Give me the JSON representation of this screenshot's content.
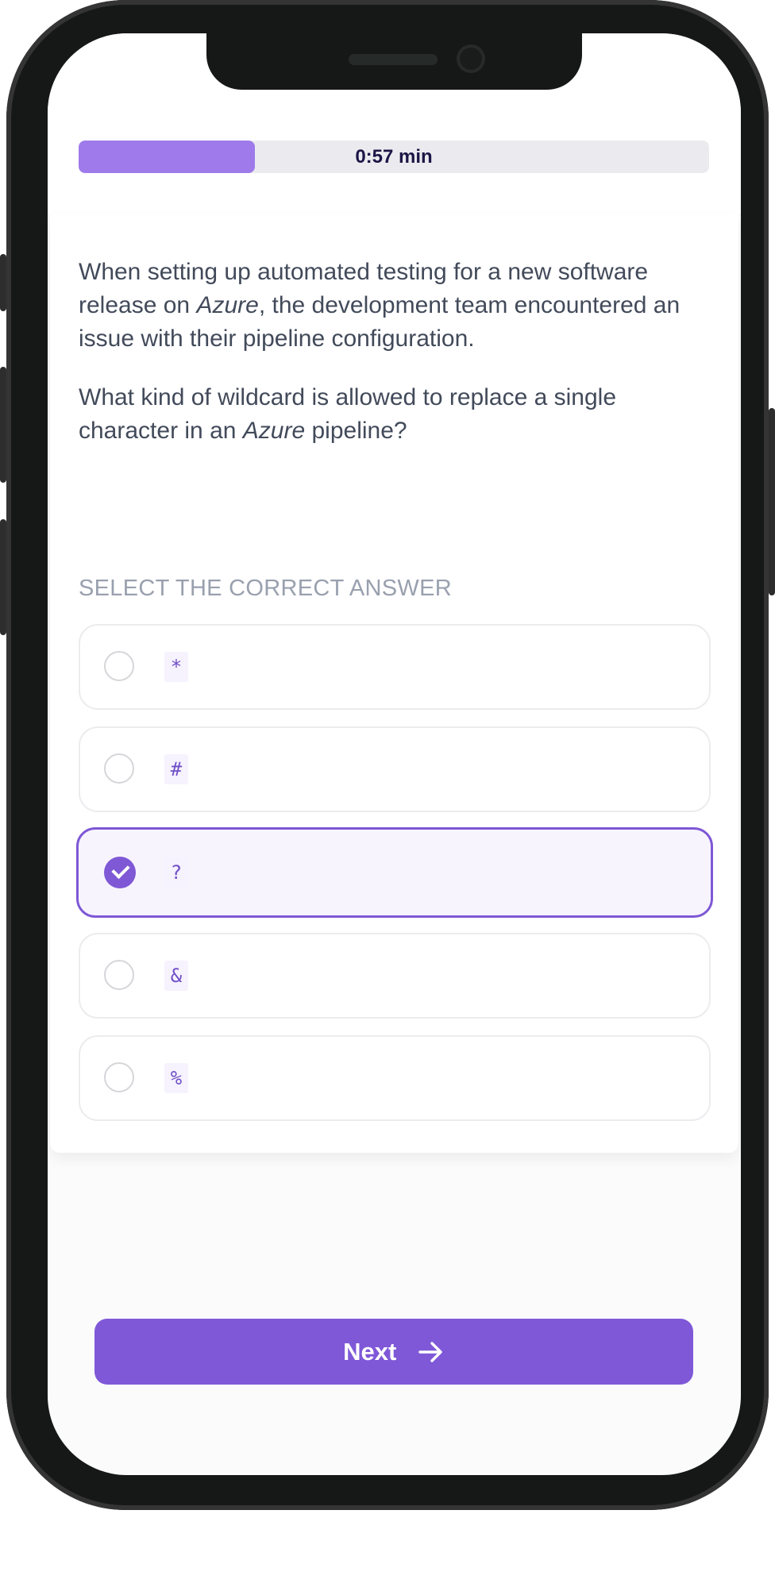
{
  "timer": {
    "label": "0:57 min",
    "progress_fraction": 0.28,
    "fill_color": "#9e7aea",
    "track_color": "#ebebef"
  },
  "question": {
    "paragraphs": [
      {
        "parts": [
          {
            "text": "When setting up automated testing for a new software release on ",
            "italic": false
          },
          {
            "text": "Azure",
            "italic": true
          },
          {
            "text": ", the development team encountered an issue with their pipeline configuration.",
            "italic": false
          }
        ]
      },
      {
        "parts": [
          {
            "text": "What kind of wildcard is allowed to replace a single character in an ",
            "italic": false
          },
          {
            "text": "Azure",
            "italic": true
          },
          {
            "text": " pipeline?",
            "italic": false
          }
        ]
      }
    ]
  },
  "answers": {
    "label": "SELECT THE CORRECT ANSWER",
    "options": [
      {
        "value": "*",
        "selected": false
      },
      {
        "value": "#",
        "selected": false
      },
      {
        "value": "?",
        "selected": true
      },
      {
        "value": "&",
        "selected": false
      },
      {
        "value": "%",
        "selected": false
      }
    ]
  },
  "footer": {
    "next_label": "Next",
    "next_icon": "arrow-right-icon"
  },
  "colors": {
    "accent": "#7f58d8",
    "selected_bg": "#f8f4fe"
  }
}
